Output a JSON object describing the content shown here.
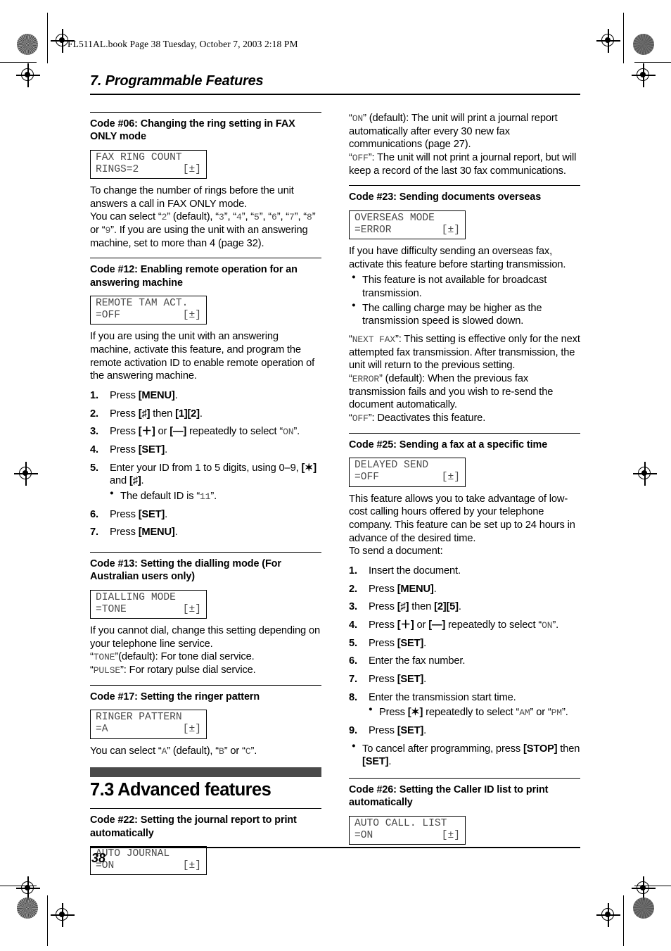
{
  "page": {
    "file_stamp": "FL511AL.book  Page 38  Tuesday, October 7, 2003  2:18 PM",
    "chapter_title": "7. Programmable Features",
    "page_number": "38"
  },
  "left_column": {
    "code06": {
      "heading": "Code #06: Changing the ring setting in FAX ONLY mode",
      "lcd_line1": "FAX RING COUNT",
      "lcd_line2_left": "RINGS=2",
      "lcd_line2_right": "[±]",
      "para1": "To change the number of rings before the unit answers a call in FAX ONLY mode.",
      "para2_a": "You can select “",
      "para2_v1": "2",
      "para2_b": "” (default), “",
      "para2_v2": "3",
      "para2_c": "”, “",
      "para2_v3": "4",
      "para2_d": "”, “",
      "para2_v4": "5",
      "para2_e": "”, “",
      "para2_v5": "6",
      "para2_f": "”, “",
      "para2_v6": "7",
      "para2_g": "”, “",
      "para2_v7": "8",
      "para2_h": "” or “",
      "para2_v8": "9",
      "para2_i": "”. If you are using the unit with an answering machine, set to more than 4 (page 32)."
    },
    "code12": {
      "heading": "Code #12: Enabling remote operation for an answering machine",
      "lcd_line1": "REMOTE TAM ACT.",
      "lcd_line2_left": "=OFF",
      "lcd_line2_right": "[±]",
      "para1": "If you are using the unit with an answering machine, activate this feature, and program the remote activation ID to enable remote operation of the answering machine.",
      "steps": [
        {
          "num": "1.",
          "pre": "Press ",
          "key1": "[MENU]",
          "post": "."
        },
        {
          "num": "2.",
          "pre": "Press ",
          "key1": "[♯]",
          "mid": " then ",
          "key2": "[1][2]",
          "post": "."
        },
        {
          "num": "3.",
          "pre": "Press ",
          "key1": "[＋]",
          "mid": " or ",
          "key2": "[—]",
          "post2": " repeatedly to select “",
          "value": "ON",
          "post": "”."
        },
        {
          "num": "4.",
          "pre": "Press ",
          "key1": "[SET]",
          "post": "."
        },
        {
          "num": "5.",
          "pre": "Enter your ID from 1 to 5 digits, using 0–9, ",
          "key1": "[✶]",
          "mid": " and ",
          "key2": "[♯]",
          "post": ".",
          "sub_pre": "The default ID is “",
          "sub_value": "11",
          "sub_post": "”."
        },
        {
          "num": "6.",
          "pre": "Press ",
          "key1": "[SET]",
          "post": "."
        },
        {
          "num": "7.",
          "pre": "Press ",
          "key1": "[MENU]",
          "post": "."
        }
      ]
    },
    "code13": {
      "heading": "Code #13: Setting the dialling mode (For Australian users only)",
      "lcd_line1": "DIALLING MODE",
      "lcd_line2_left": "=TONE",
      "lcd_line2_right": "[±]",
      "para1": "If you cannot dial, change this setting depending on your telephone line service.",
      "opt1_q": "“",
      "opt1_v": "TONE",
      "opt1_t": "”(default): For tone dial service.",
      "opt2_q": "“",
      "opt2_v": "PULSE",
      "opt2_t": "”: For rotary pulse dial service."
    },
    "code17": {
      "heading": "Code #17: Setting the ringer pattern",
      "lcd_line1": "RINGER PATTERN",
      "lcd_line2_left": "=A",
      "lcd_line2_right": "[±]",
      "para1_a": "You can select “",
      "para1_v1": "A",
      "para1_b": "” (default), “",
      "para1_v2": "B",
      "para1_c": "” or “",
      "para1_v3": "C",
      "para1_d": "”."
    },
    "section73": {
      "title": "7.3 Advanced features"
    },
    "code22": {
      "heading": "Code #22: Setting the journal report to print automatically",
      "lcd_line1": "AUTO JOURNAL",
      "lcd_line2_left": "=ON",
      "lcd_line2_right": "[±]"
    }
  },
  "right_column": {
    "code22_cont": {
      "opt1_q": "“",
      "opt1_v": "ON",
      "opt1_t": "” (default): The unit will print a journal report automatically after every 30 new fax communications (page 27).",
      "opt2_q": "“",
      "opt2_v": "OFF",
      "opt2_t": "”: The unit will not print a journal report, but will keep a record of the last 30 fax communications."
    },
    "code23": {
      "heading": "Code #23: Sending documents overseas",
      "lcd_line1": "OVERSEAS MODE",
      "lcd_line2_left": "=ERROR",
      "lcd_line2_right": "[±]",
      "para1": "If you have difficulty sending an overseas fax, activate this feature before starting transmission.",
      "bullets": [
        "This feature is not available for broadcast transmission.",
        "The calling charge may be higher as the transmission speed is slowed down."
      ],
      "opt1_q": "“",
      "opt1_v": "NEXT FAX",
      "opt1_t": "”: This setting is effective only for the next attempted fax transmission. After transmission, the unit will return to the previous setting.",
      "opt2_q": "“",
      "opt2_v": "ERROR",
      "opt2_t": "” (default): When the previous fax transmission fails and you wish to re-send the document automatically.",
      "opt3_q": "“",
      "opt3_v": "OFF",
      "opt3_t": "”: Deactivates this feature."
    },
    "code25": {
      "heading": "Code #25: Sending a fax at a specific time",
      "lcd_line1": "DELAYED SEND",
      "lcd_line2_left": "=OFF",
      "lcd_line2_right": "[±]",
      "para1": "This feature allows you to take advantage of low-cost calling hours offered by your telephone company. This feature can be set up to 24 hours in advance of the desired time.",
      "para2": "To send a document:",
      "steps": [
        {
          "num": "1.",
          "pre": "Insert the document."
        },
        {
          "num": "2.",
          "pre": "Press ",
          "key1": "[MENU]",
          "post": "."
        },
        {
          "num": "3.",
          "pre": "Press ",
          "key1": "[♯]",
          "mid": " then ",
          "key2": "[2][5]",
          "post": "."
        },
        {
          "num": "4.",
          "pre": "Press ",
          "key1": "[＋]",
          "mid": " or ",
          "key2": "[—]",
          "post2": " repeatedly to select “",
          "value": "ON",
          "post": "”."
        },
        {
          "num": "5.",
          "pre": "Press ",
          "key1": "[SET]",
          "post": "."
        },
        {
          "num": "6.",
          "pre": "Enter the fax number."
        },
        {
          "num": "7.",
          "pre": "Press ",
          "key1": "[SET]",
          "post": "."
        },
        {
          "num": "8.",
          "pre": "Enter the transmission start time.",
          "sub_pre": "Press ",
          "sub_key": "[✶]",
          "sub_mid": " repeatedly to select “",
          "sub_v1": "AM",
          "sub_mid2": "” or “",
          "sub_v2": "PM",
          "sub_post": "”."
        },
        {
          "num": "9.",
          "pre": "Press ",
          "key1": "[SET]",
          "post": "."
        }
      ],
      "final_note_pre": "To cancel after programming, press ",
      "final_note_key1": "[STOP]",
      "final_note_mid": " then ",
      "final_note_key2": "[SET]",
      "final_note_post": "."
    },
    "code26": {
      "heading": "Code #26: Setting the Caller ID list to print automatically",
      "lcd_line1": "AUTO CALL. LIST",
      "lcd_line2_left": "=ON",
      "lcd_line2_right": "[±]"
    }
  }
}
